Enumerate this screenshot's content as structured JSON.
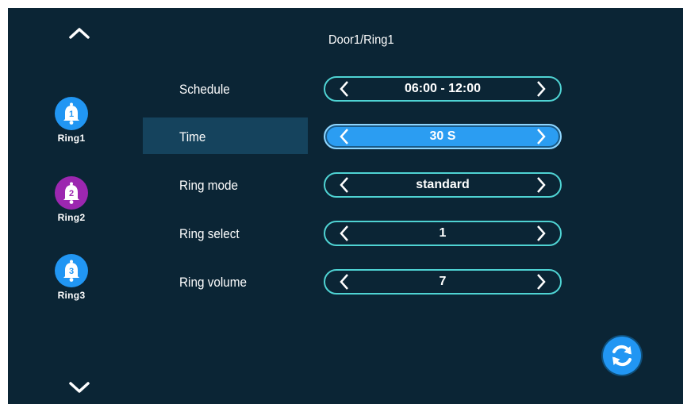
{
  "title": "Door1/Ring1",
  "sidebar": {
    "up_icon": "chevron-up-icon",
    "down_icon": "chevron-down-icon",
    "rings": [
      {
        "label": "Ring1",
        "number": "1",
        "icon": "bell-icon",
        "color": "#2196f3"
      },
      {
        "label": "Ring2",
        "number": "2",
        "icon": "bell-icon",
        "color": "#9c27b0"
      },
      {
        "label": "Ring3",
        "number": "3",
        "icon": "bell-icon",
        "color": "#2196f3"
      }
    ]
  },
  "settings": [
    {
      "label": "Schedule",
      "value": "06:00 - 12:00",
      "selected": false
    },
    {
      "label": "Time",
      "value": "30 S",
      "selected": true
    },
    {
      "label": "Ring mode",
      "value": "standard",
      "selected": false
    },
    {
      "label": "Ring select",
      "value": "1",
      "selected": false
    },
    {
      "label": "Ring volume",
      "value": "7",
      "selected": false
    }
  ],
  "refresh_icon": "refresh-icon",
  "colors": {
    "background": "#0b2535",
    "selected_row": "#15435d",
    "stepper_border": "#4fd3d3",
    "stepper_active": "#2b9df2"
  }
}
